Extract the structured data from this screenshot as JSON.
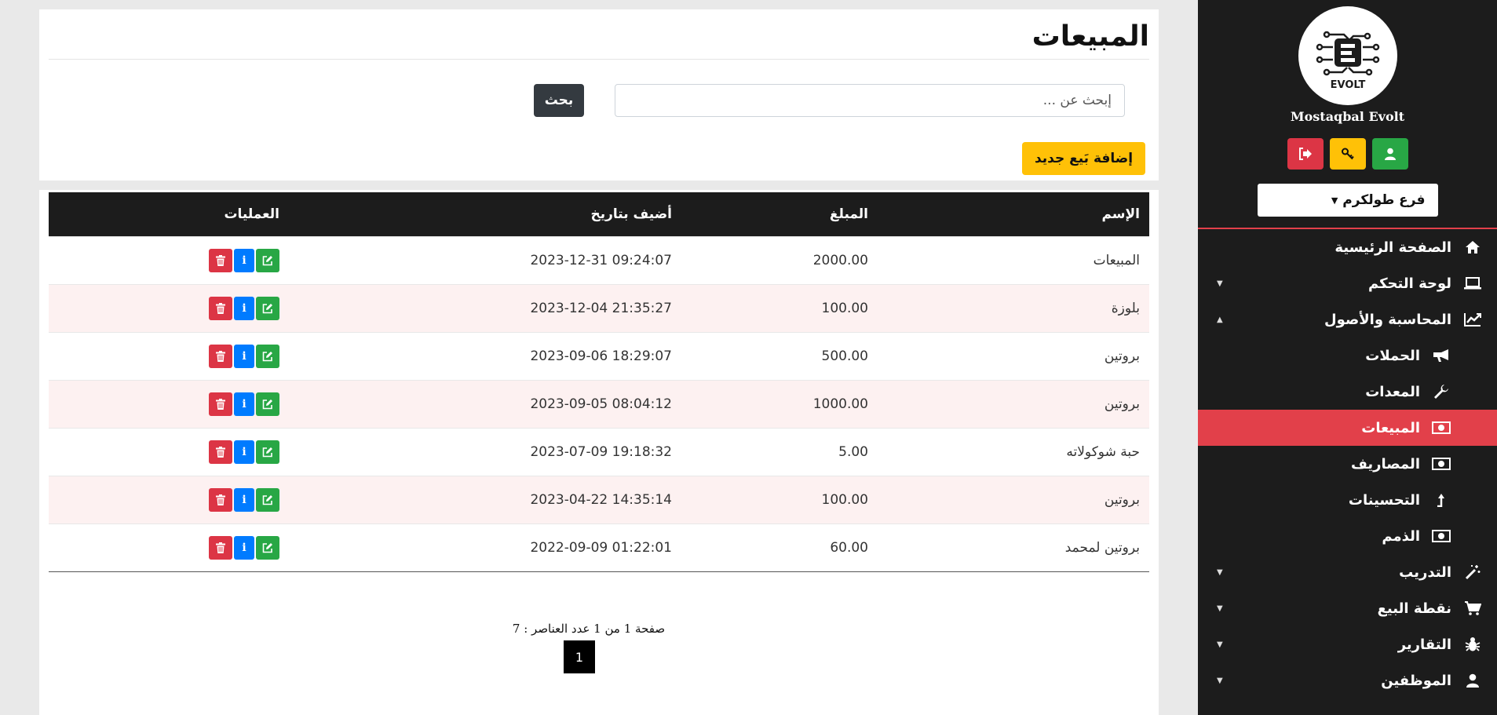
{
  "sidebar": {
    "logo_text": "EVOLT",
    "brand_name": "Mostaqbal Evolt",
    "branch": "فرع طولكرم",
    "nav": [
      {
        "label": "الصفحة الرئيسية",
        "icon": "home-icon"
      },
      {
        "label": "لوحة التحكم",
        "icon": "laptop-icon"
      },
      {
        "label": "المحاسبة والأصول",
        "icon": "chart-line-icon"
      },
      {
        "label": "الحملات",
        "icon": "bullhorn-icon"
      },
      {
        "label": "المعدات",
        "icon": "wrench-icon"
      },
      {
        "label": "المبيعات",
        "icon": "money-bill-icon"
      },
      {
        "label": "المصاريف",
        "icon": "money-bill-icon"
      },
      {
        "label": "التحسينات",
        "icon": "level-up-icon"
      },
      {
        "label": "الذمم",
        "icon": "money-bill-icon"
      },
      {
        "label": "التدريب",
        "icon": "magic-wand-icon"
      },
      {
        "label": "نقطة البيع",
        "icon": "cart-icon"
      },
      {
        "label": "التقارير",
        "icon": "bug-icon"
      },
      {
        "label": "الموظفين",
        "icon": "user-icon"
      }
    ]
  },
  "page": {
    "title": "المبيعات",
    "search_placeholder": "إبحث عن ...",
    "search_button": "بحث",
    "add_button": "إضافة بَيع جديد"
  },
  "table": {
    "headers": [
      "الإسم",
      "المبلغ",
      "أضيف بتاريخ",
      "العمليات"
    ],
    "rows": [
      {
        "name": "المبيعات",
        "amount": "2000.00",
        "date": "2023-12-31 09:24:07"
      },
      {
        "name": "بلوزة",
        "amount": "100.00",
        "date": "2023-12-04 21:35:27"
      },
      {
        "name": "بروتين",
        "amount": "500.00",
        "date": "2023-09-06 18:29:07"
      },
      {
        "name": "بروتين",
        "amount": "1000.00",
        "date": "2023-09-05 08:04:12"
      },
      {
        "name": "حبة شوكولاته",
        "amount": "5.00",
        "date": "2023-07-09 19:18:32"
      },
      {
        "name": "بروتين",
        "amount": "100.00",
        "date": "2023-04-22 14:35:14"
      },
      {
        "name": "بروتين لمحمد",
        "amount": "60.00",
        "date": "2022-09-09 01:22:01"
      }
    ]
  },
  "pagination": {
    "info": "صفحة 1 من 1 عدد العناصر : 7",
    "current_page": "1"
  },
  "colors": {
    "sidebar_bg": "#1c1c1c",
    "active_red": "#e2404a",
    "add_yellow": "#ffc107",
    "edit_green": "#28a745",
    "info_blue": "#007bff",
    "delete_red": "#dc3545"
  }
}
